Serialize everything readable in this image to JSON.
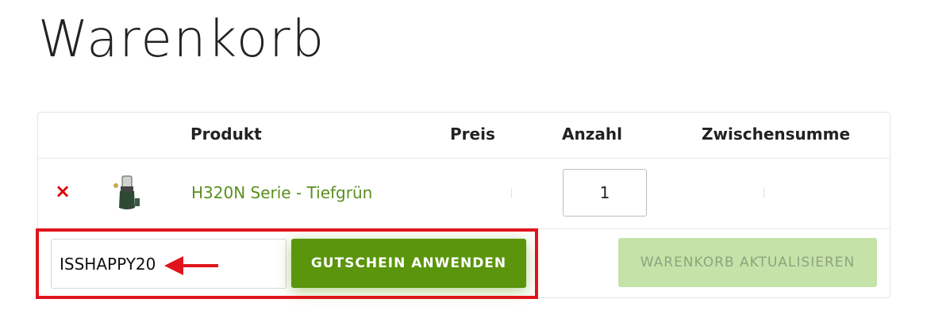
{
  "page": {
    "title": "Warenkorb"
  },
  "table": {
    "headers": {
      "product": "Produkt",
      "price": "Preis",
      "quantity": "Anzahl",
      "subtotal": "Zwischensumme"
    },
    "rows": [
      {
        "remove_symbol": "×",
        "product_name": "H320N Serie - Tiefgrün",
        "quantity": "1"
      }
    ]
  },
  "coupon": {
    "code": "ISSHAPPY20",
    "apply_label": "GUTSCHEIN ANWENDEN"
  },
  "update_label": "WARENKORB AKTUALISIEREN",
  "colors": {
    "accent_green": "#5a950b",
    "link_green": "#5a8f1e",
    "disabled_green": "#c5e3a8",
    "highlight_red": "#e0141b",
    "remove_red": "#e00000"
  },
  "icons": {
    "remove": "remove-x-icon",
    "arrow": "red-arrow-left-icon"
  }
}
